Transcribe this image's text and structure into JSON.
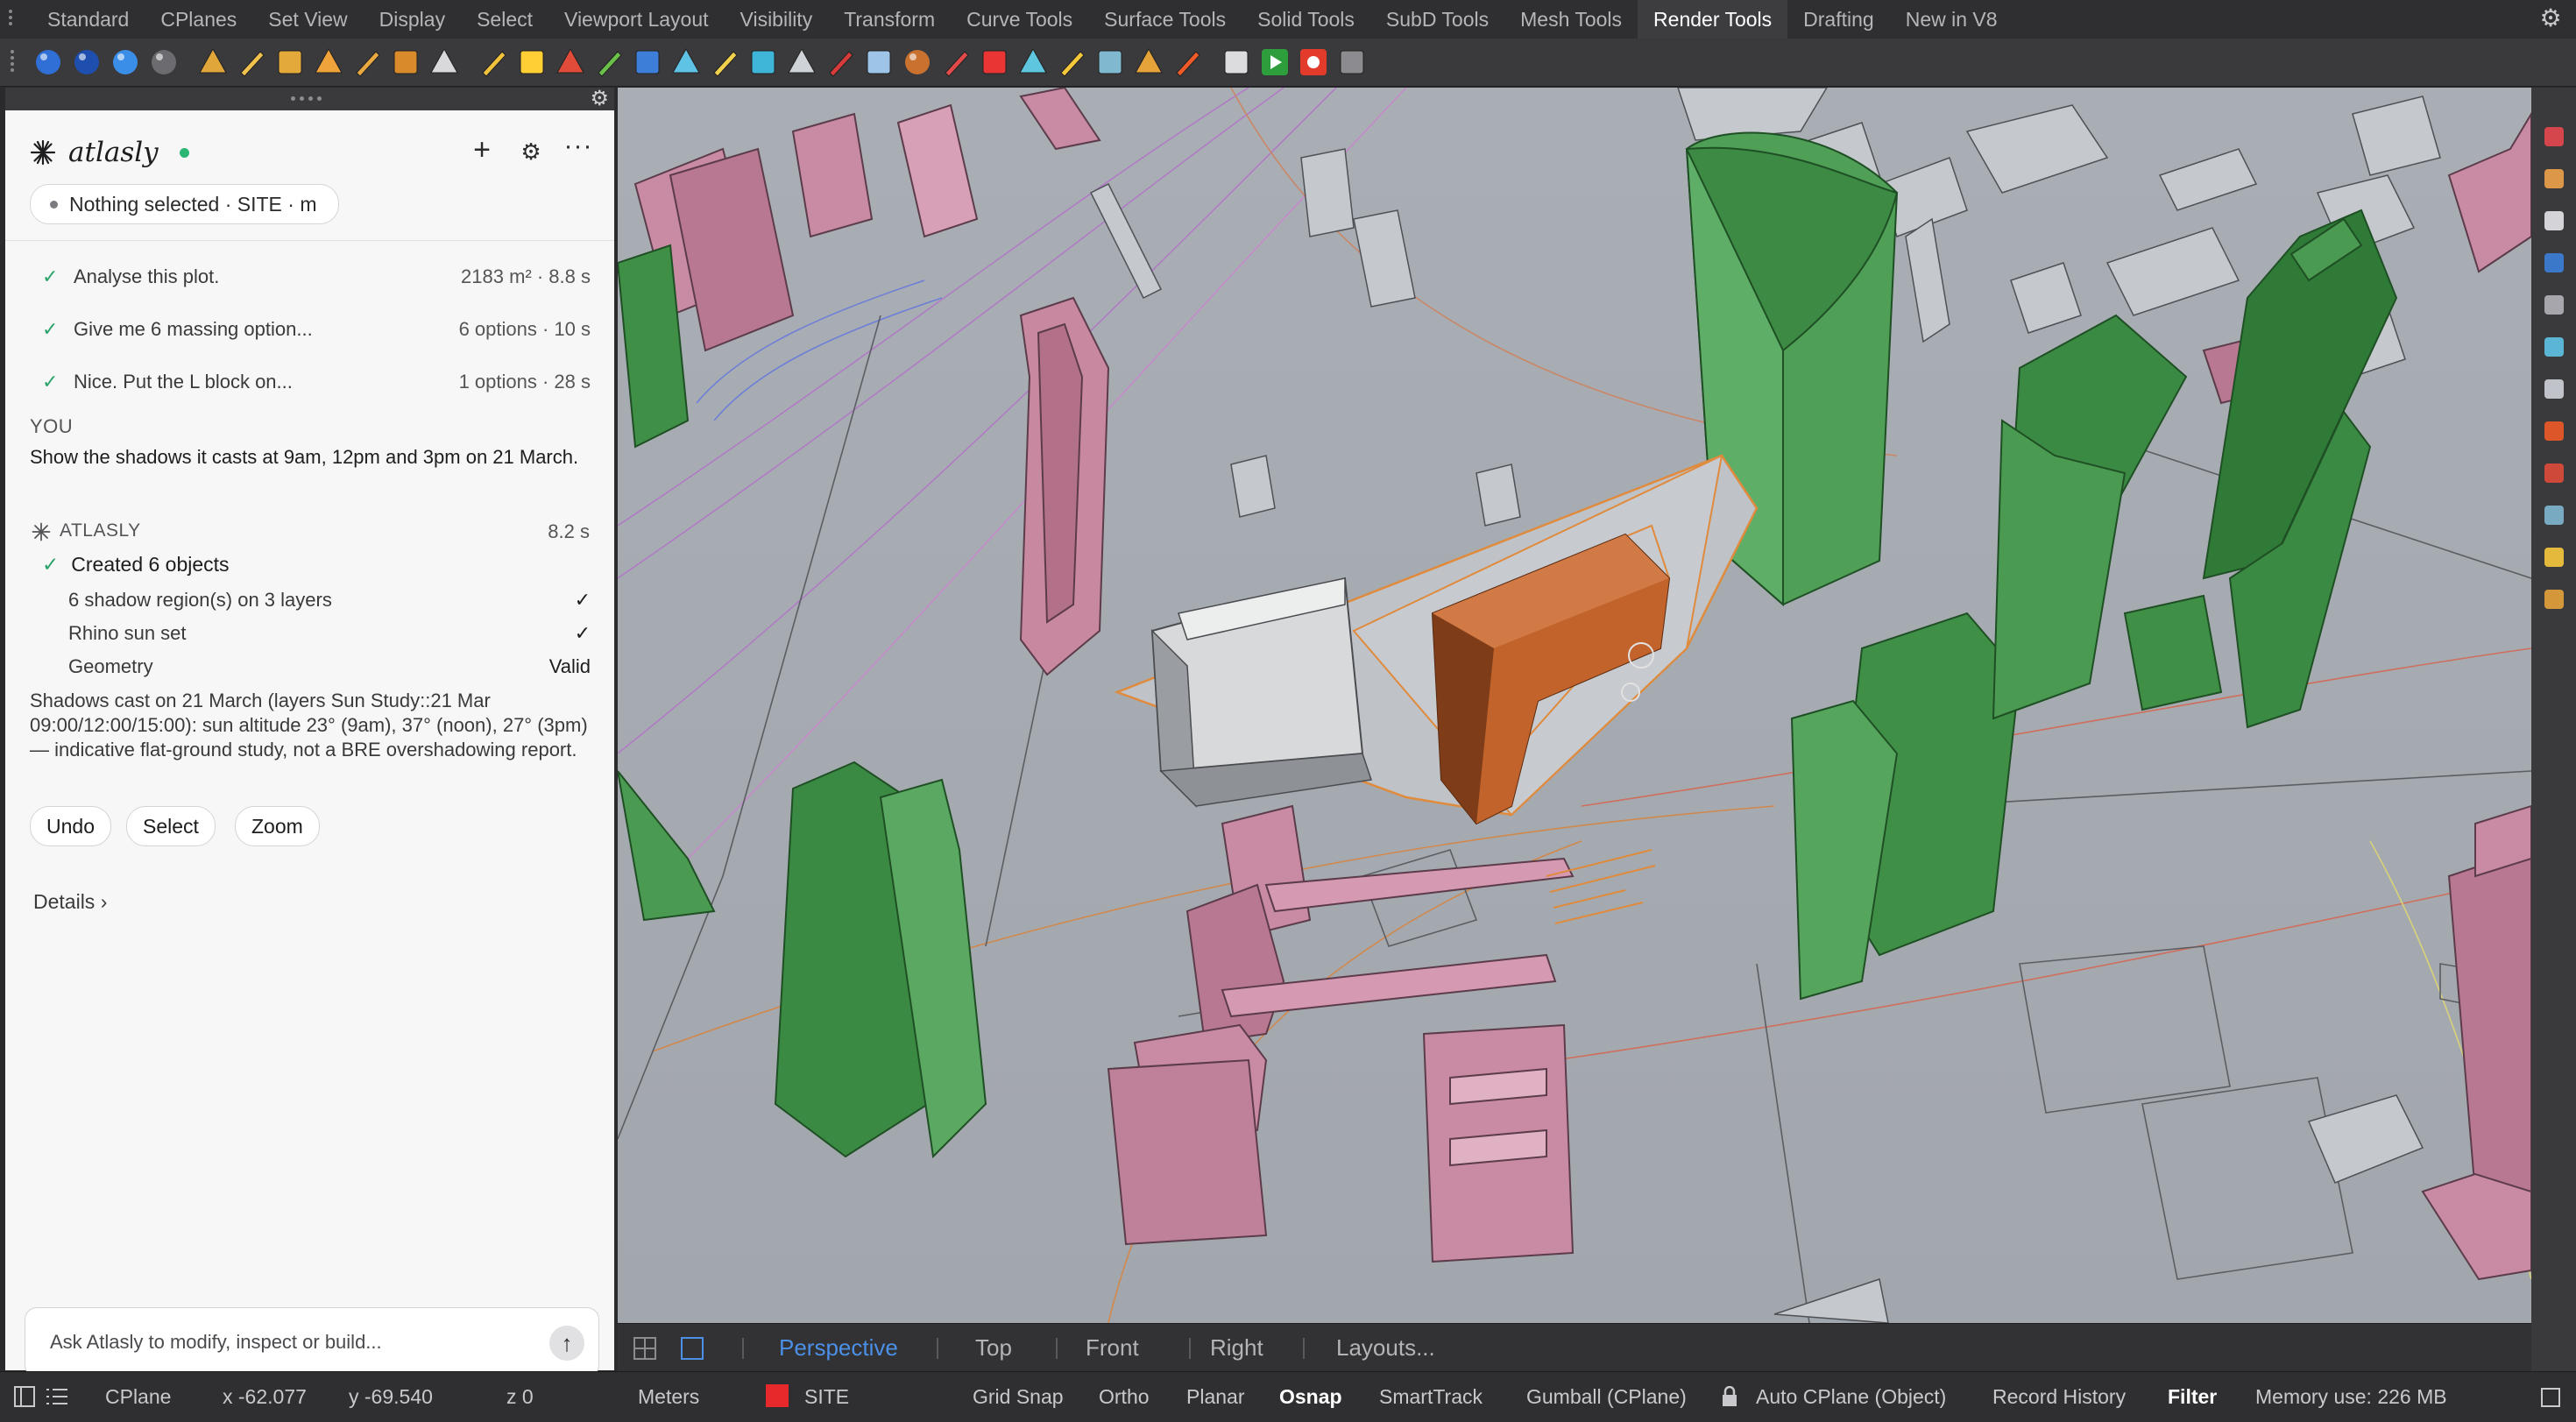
{
  "menubar": {
    "tabs": [
      "Standard",
      "CPlanes",
      "Set View",
      "Display",
      "Select",
      "Viewport Layout",
      "Visibility",
      "Transform",
      "Curve Tools",
      "Surface Tools",
      "Solid Tools",
      "SubD Tools",
      "Mesh Tools",
      "Render Tools",
      "Drafting",
      "New in V8"
    ],
    "active_tab": "Render Tools"
  },
  "toolbar": {
    "icons": [
      "sphere-render-icon",
      "sphere-blue-icon",
      "sphere-material-icon",
      "sphere-save-icon",
      "spotlight-icon",
      "point-light-icon",
      "directional-light-icon",
      "rectangular-light-icon",
      "linear-light-icon",
      "light-arrow-icon",
      "ground-plane-icon",
      "sun-icon",
      "environment-icon",
      "material-editor-icon",
      "texture-icon",
      "decal-icon",
      "camera-icon",
      "viewport-icon",
      "box-mapping-icon",
      "curve-icon",
      "texture-palette-icon",
      "wrap-icon",
      "sphere-texture-icon",
      "paint-icon",
      "color-palette-icon",
      "cloud-icon",
      "light-bulb-icon",
      "grid-icon",
      "graph-icon",
      "splash-icon",
      "render-window-icon",
      "render-play-icon",
      "render-record-icon",
      "turntable-icon"
    ]
  },
  "panel": {
    "brand": "atlasly",
    "status_color": "#2bb673",
    "context": "Nothing selected · SITE · m",
    "history": [
      {
        "text": "Analyse this plot.",
        "meta": "2183 m² · 8.8 s"
      },
      {
        "text": "Give me 6 massing option...",
        "meta": "6 options · 10 s"
      },
      {
        "text": "Nice. Put the L block on...",
        "meta": "1 options · 28 s"
      }
    ],
    "you_label": "YOU",
    "you_message": "Show the shadows it casts at 9am, 12pm and 3pm on 21 March.",
    "atlasly_label": "ATLASLY",
    "atlasly_time": "8.2 s",
    "created": "Created 6 objects",
    "details_rows": [
      {
        "label": "6 shadow region(s) on 3 layers",
        "value": "✓"
      },
      {
        "label": "Rhino sun set",
        "value": "✓"
      },
      {
        "label": "Geometry",
        "value": "Valid"
      }
    ],
    "summary": "Shadows cast on 21 March (layers Sun Study::21 Mar 09:00/12:00/15:00): sun altitude 23° (9am), 37° (noon), 27° (3pm) — indicative flat-ground study, not a BRE overshadowing report.",
    "actions": [
      "Undo",
      "Select",
      "Zoom"
    ],
    "details_link": "Details ›",
    "ask_placeholder": "Ask Atlasly to modify, inspect or build..."
  },
  "viewport_tabs": {
    "tabs": [
      "Perspective",
      "Top",
      "Front",
      "Right",
      "Layouts..."
    ],
    "active": "Perspective"
  },
  "statusbar": {
    "cplane": "CPlane",
    "x": "x -62.077",
    "y": "y -69.540",
    "z": "z 0",
    "units": "Meters",
    "layer": "SITE",
    "layer_color": "#e8292c",
    "toggles": [
      "Grid Snap",
      "Ortho",
      "Planar",
      "Osnap",
      "SmartTrack",
      "Gumball (CPlane)",
      "Auto CPlane (Object)",
      "Record History",
      "Filter"
    ],
    "active_toggles": [
      "Osnap",
      "Filter"
    ],
    "memory": "Memory use: 226 MB"
  },
  "colors": {
    "massing_green": "#3f8f46",
    "existing_pink": "#c97f9c",
    "proposal_orange": "#c2632b",
    "viewport_bg": "#a8adb3"
  }
}
